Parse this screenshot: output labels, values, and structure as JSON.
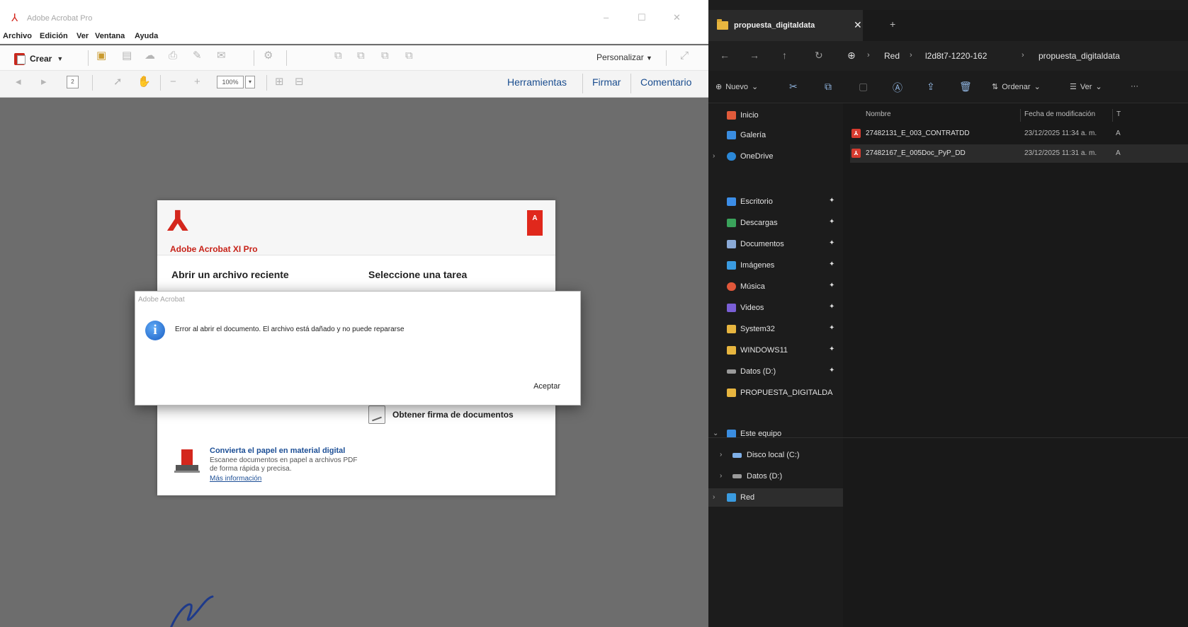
{
  "acrobat": {
    "window_title": "Adobe Acrobat Pro",
    "menu": [
      "Archivo",
      "Edición",
      "Ver",
      "Ventana",
      "Ayuda"
    ],
    "toolbar": {
      "create_label": "Crear",
      "customize_label": "Personalizar",
      "page_number": "2",
      "zoom": "100%"
    },
    "panels": {
      "tools": "Herramientas",
      "sign": "Firmar",
      "comment": "Comentario"
    },
    "welcome": {
      "brand": "Adobe Acrobat XI Pro",
      "recent_title": "Abrir un archivo reciente",
      "task_title": "Seleccione una tarea",
      "get_signature": "Obtener firma de documentos",
      "promo_title": "Convierta el papel en material digital",
      "promo_desc": "Escanee documentos en papel a archivos PDF de forma rápida y precisa.",
      "promo_link": "Más información"
    },
    "dialog": {
      "title": "Adobe Acrobat",
      "message": "Error al abrir el documento. El archivo está dañado y no puede repararse",
      "ok_label": "Aceptar"
    }
  },
  "explorer": {
    "tab_title": "propuesta_digitaldata",
    "breadcrumb": [
      "Red",
      "l2d8t7-1220-162",
      "propuesta_digitaldata"
    ],
    "commands": {
      "new": "Nuevo",
      "sort": "Ordenar",
      "view": "Ver"
    },
    "nav_items": [
      {
        "label": "Inicio",
        "icon": "home-icon",
        "color": "#e05a3a"
      },
      {
        "label": "Galería",
        "icon": "gallery-icon",
        "color": "#3a8de0"
      },
      {
        "label": "OneDrive",
        "icon": "cloud-icon",
        "color": "#2b88d8"
      },
      {
        "label": "Escritorio",
        "icon": "desktop-icon",
        "color": "#3c8ee8"
      },
      {
        "label": "Descargas",
        "icon": "download-icon",
        "color": "#3aa35b"
      },
      {
        "label": "Documentos",
        "icon": "documents-icon",
        "color": "#8aa9d6"
      },
      {
        "label": "Imágenes",
        "icon": "images-icon",
        "color": "#3a9be0"
      },
      {
        "label": "Música",
        "icon": "music-icon",
        "color": "#e0573a"
      },
      {
        "label": "Videos",
        "icon": "videos-icon",
        "color": "#7a5fd6"
      },
      {
        "label": "System32",
        "icon": "folder-icon",
        "color": "#e7b53f"
      },
      {
        "label": "WINDOWS11",
        "icon": "folder-icon",
        "color": "#e7b53f"
      },
      {
        "label": "Datos (D:)",
        "icon": "drive-icon",
        "color": "#9a9a9a"
      },
      {
        "label": "PROPUESTA_DIGITALDA",
        "icon": "folder-icon",
        "color": "#e7b53f"
      },
      {
        "label": "Este equipo",
        "icon": "computer-icon",
        "color": "#3a8de0"
      },
      {
        "label": "Disco local (C:)",
        "icon": "drive-icon",
        "color": "#7fb0e8"
      },
      {
        "label": "Datos (D:)",
        "icon": "drive-icon",
        "color": "#9a9a9a"
      },
      {
        "label": "Red",
        "icon": "network-icon",
        "color": "#3a9be0"
      }
    ],
    "columns": {
      "name": "Nombre",
      "date": "Fecha de modificación",
      "type": "T"
    },
    "files": [
      {
        "name": "27482131_E_003_CONTRATDD",
        "date": "23/12/2025 11:34 a. m.",
        "type": "A"
      },
      {
        "name": "27482167_E_005Doc_PyP_DD",
        "date": "23/12/2025 11:31 a. m.",
        "type": "A"
      }
    ]
  }
}
